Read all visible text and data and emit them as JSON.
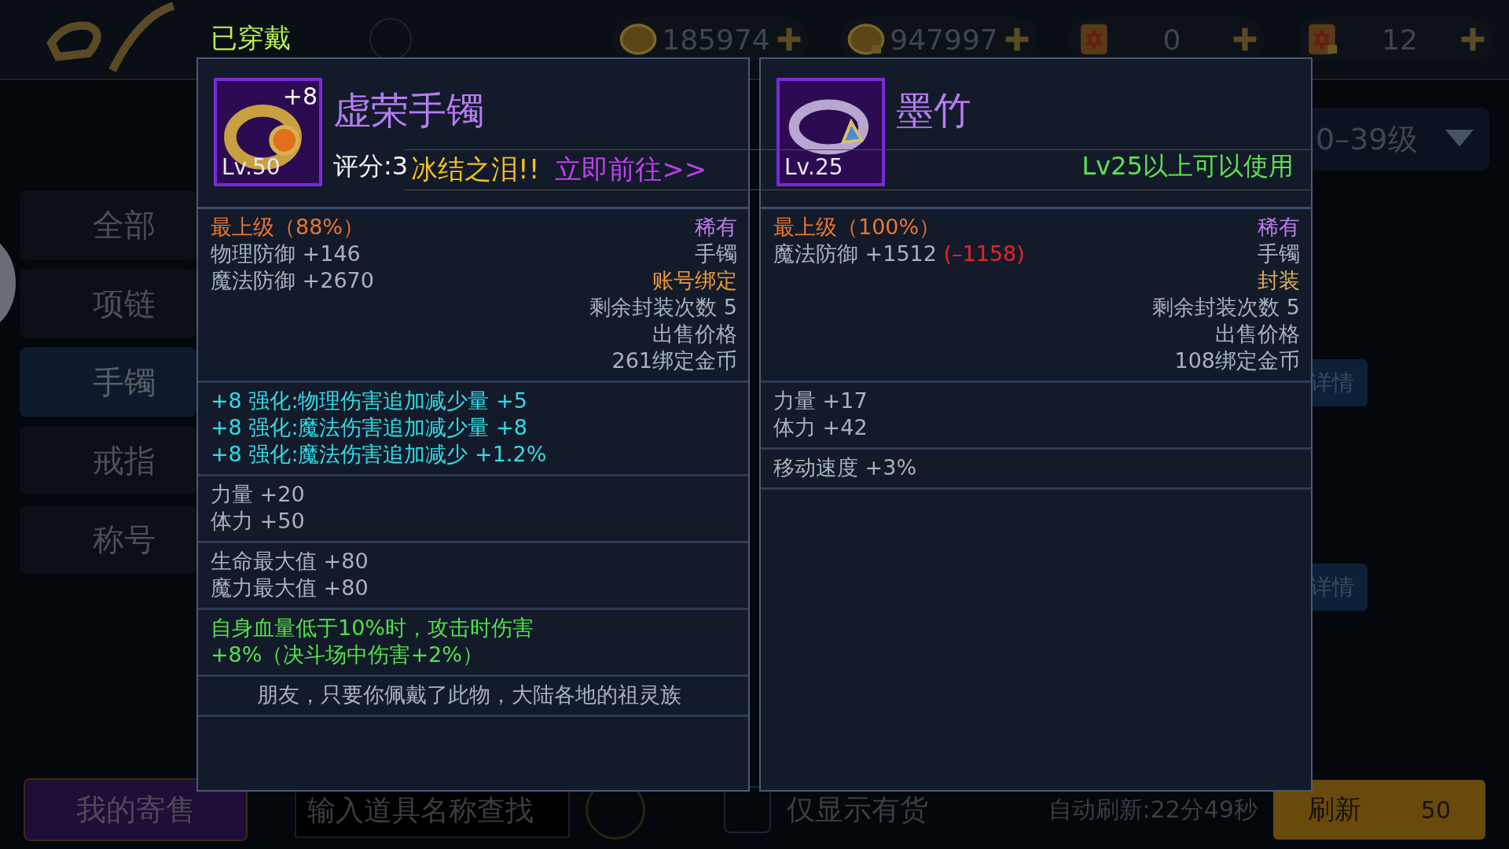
{
  "equipped_label": "已穿戴",
  "top_bar": {
    "currencies": [
      {
        "kind": "coin",
        "amount": "185974",
        "locked": false
      },
      {
        "kind": "coin",
        "amount": "947997",
        "locked": true
      },
      {
        "kind": "scroll",
        "amount": "0",
        "locked": false
      },
      {
        "kind": "scroll",
        "amount": "12",
        "locked": true
      }
    ]
  },
  "level_filter": {
    "value": "0–39级"
  },
  "sidebar": {
    "tabs": [
      {
        "label": "全部",
        "selected": false
      },
      {
        "label": "项链",
        "selected": false
      },
      {
        "label": "手镯",
        "selected": true
      },
      {
        "label": "戒指",
        "selected": false
      },
      {
        "label": "称号",
        "selected": false
      }
    ]
  },
  "detail_buttons": [
    "详情",
    "详情"
  ],
  "bottom_bar": {
    "my_sales_button": "我的寄售",
    "search": {
      "placeholder": "输入道具名称查找"
    },
    "in_stock_only": {
      "label": "仅显示有货",
      "checked": false
    },
    "auto_refresh": "自动刷新:22分49秒",
    "refresh_button": {
      "label": "刷新",
      "cost": "50"
    }
  },
  "banner": {
    "message": "冰结之泪!!",
    "link": "立即前往>>"
  },
  "item_cards": [
    {
      "kind": "bracelet",
      "name": "虚荣手镯",
      "enhance": "+8",
      "level": "Lv.50",
      "score": "评分:3",
      "sections": [
        {
          "kind": "stats",
          "lines": [
            {
              "left": [
                {
                  "text": "最上级（88%）",
                  "color": "#e8772e"
                }
              ],
              "right": {
                "text": "稀有",
                "color": "#c07ae8"
              }
            },
            {
              "left": [
                {
                  "text": "物理防御 +146",
                  "color": "#a7b2c0"
                }
              ],
              "right": {
                "text": "手镯",
                "color": "#a7b2c0"
              }
            },
            {
              "left": [
                {
                  "text": "魔法防御 +2670",
                  "color": "#a7b2c0"
                }
              ],
              "right": {
                "text": "账号绑定",
                "color": "#e89a3c"
              }
            },
            {
              "right": {
                "text": "剩余封装次数 5",
                "color": "#a7b2c0"
              }
            },
            {
              "right": {
                "text": "出售价格",
                "color": "#a7b2c0"
              }
            },
            {
              "right": {
                "text": "261绑定金币",
                "color": "#a7b2c0"
              }
            }
          ]
        },
        {
          "kind": "stats",
          "lines": [
            {
              "left": [
                {
                  "text": "+8 强化:物理伤害追加减少量 +5",
                  "color": "#2fdde6"
                }
              ]
            },
            {
              "left": [
                {
                  "text": "+8 强化:魔法伤害追加减少量 +8",
                  "color": "#2fdde6"
                }
              ]
            },
            {
              "left": [
                {
                  "text": "+8 强化:魔法伤害追加减少 +1.2%",
                  "color": "#2fdde6"
                }
              ]
            }
          ]
        },
        {
          "kind": "stats",
          "lines": [
            {
              "left": [
                {
                  "text": "力量 +20",
                  "color": "#a7b2c0"
                }
              ]
            },
            {
              "left": [
                {
                  "text": "体力 +50",
                  "color": "#a7b2c0"
                }
              ]
            }
          ]
        },
        {
          "kind": "stats",
          "lines": [
            {
              "left": [
                {
                  "text": "生命最大值 +80",
                  "color": "#a7b2c0"
                }
              ]
            },
            {
              "left": [
                {
                  "text": "魔力最大值 +80",
                  "color": "#a7b2c0"
                }
              ]
            }
          ]
        },
        {
          "kind": "effect",
          "lines": [
            {
              "left": [
                {
                  "text": "自身血量低于10%时，攻击时伤害",
                  "color": "#4fe24a"
                }
              ]
            },
            {
              "left": [
                {
                  "text": "+8%（决斗场中伤害+2%）",
                  "color": "#4fe24a"
                }
              ]
            }
          ]
        },
        {
          "kind": "description",
          "lines": [
            {
              "left": [
                {
                  "text": "朋友，只要你佩戴了此物，大陆各地的祖灵族",
                  "color": "#a7b2c0"
                }
              ]
            }
          ]
        }
      ]
    },
    {
      "kind": "ring",
      "name": "墨竹",
      "level": "Lv.25",
      "requirement": "Lv25以上可以使用",
      "sections": [
        {
          "kind": "stats",
          "lines": [
            {
              "left": [
                {
                  "text": "最上级（100%）",
                  "color": "#e8772e"
                }
              ],
              "right": {
                "text": "稀有",
                "color": "#c07ae8"
              }
            },
            {
              "left": [
                {
                  "text": "魔法防御 +1512 ",
                  "color": "#a7b2c0"
                },
                {
                  "text": "(–1158)",
                  "color": "#f0202a"
                }
              ],
              "right": {
                "text": "手镯",
                "color": "#a7b2c0"
              }
            },
            {
              "right": {
                "text": "封装",
                "color": "#e0b055"
              }
            },
            {
              "right": {
                "text": "剩余封装次数 5",
                "color": "#a7b2c0"
              }
            },
            {
              "right": {
                "text": "出售价格",
                "color": "#a7b2c0"
              }
            },
            {
              "right": {
                "text": "108绑定金币",
                "color": "#a7b2c0"
              }
            }
          ]
        },
        {
          "kind": "stats",
          "lines": [
            {
              "left": [
                {
                  "text": "力量 +17",
                  "color": "#a7b2c0"
                }
              ]
            },
            {
              "left": [
                {
                  "text": "体力 +42",
                  "color": "#a7b2c0"
                }
              ]
            }
          ]
        },
        {
          "kind": "stats",
          "lines": [
            {
              "left": [
                {
                  "text": "移动速度 +3%",
                  "color": "#a7b2c0"
                }
              ]
            }
          ]
        }
      ]
    }
  ]
}
